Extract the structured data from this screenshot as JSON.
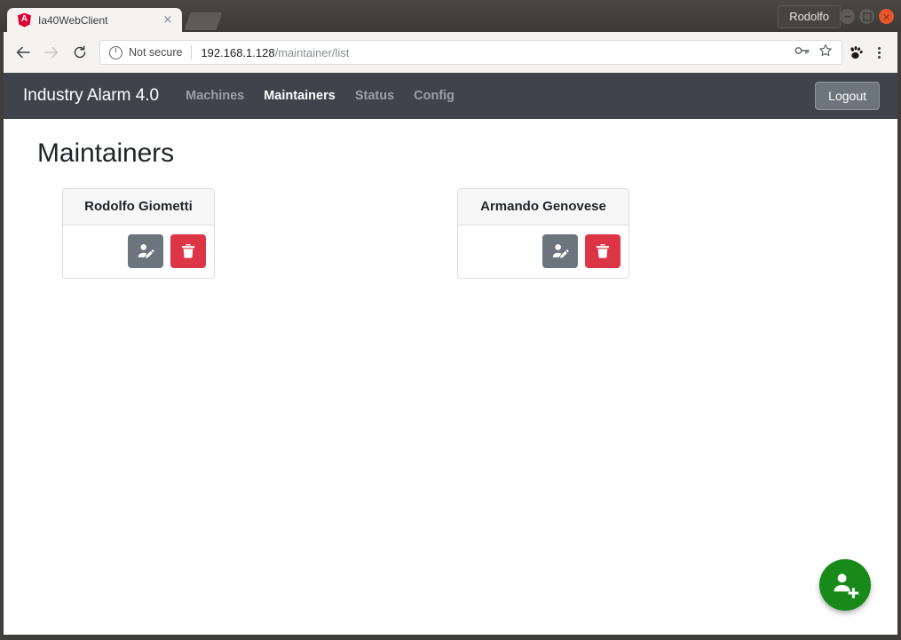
{
  "browser": {
    "tab": {
      "title": "Ia40WebClient",
      "favicon": "angular-icon",
      "close_label": "×"
    },
    "newtab_label": "",
    "profile_name": "Rodolfo",
    "window_controls": {
      "minimize": "minimize-button",
      "maximize": "maximize-button",
      "close": "×"
    },
    "toolbar": {
      "back": "←",
      "forward": "→",
      "reload": "⟳",
      "security_text": "Not secure",
      "url_host": "192.168.1.128",
      "url_path": "/maintainer/list",
      "full_url": "192.168.1.128/maintainer/list"
    }
  },
  "app": {
    "brand": "Industry Alarm 4.0",
    "nav": [
      {
        "label": "Machines",
        "active": false
      },
      {
        "label": "Maintainers",
        "active": true
      },
      {
        "label": "Status",
        "active": false
      },
      {
        "label": "Config",
        "active": false
      }
    ],
    "logout_label": "Logout",
    "page_title": "Maintainers",
    "maintainers": [
      {
        "name": "Rodolfo Giometti",
        "edit_label": "edit-maintainer",
        "delete_label": "delete-maintainer"
      },
      {
        "name": "Armando Genovese",
        "edit_label": "edit-maintainer",
        "delete_label": "delete-maintainer"
      }
    ],
    "fab": {
      "label": "add-maintainer",
      "icon": "person-add-icon"
    },
    "colors": {
      "navbar_bg": "#3e434c",
      "edit_button": "#6c757d",
      "delete_button": "#dc3545",
      "fab": "#188a1a",
      "card_header_bg": "#f7f7f7",
      "card_border": "#dcdcdc"
    }
  }
}
